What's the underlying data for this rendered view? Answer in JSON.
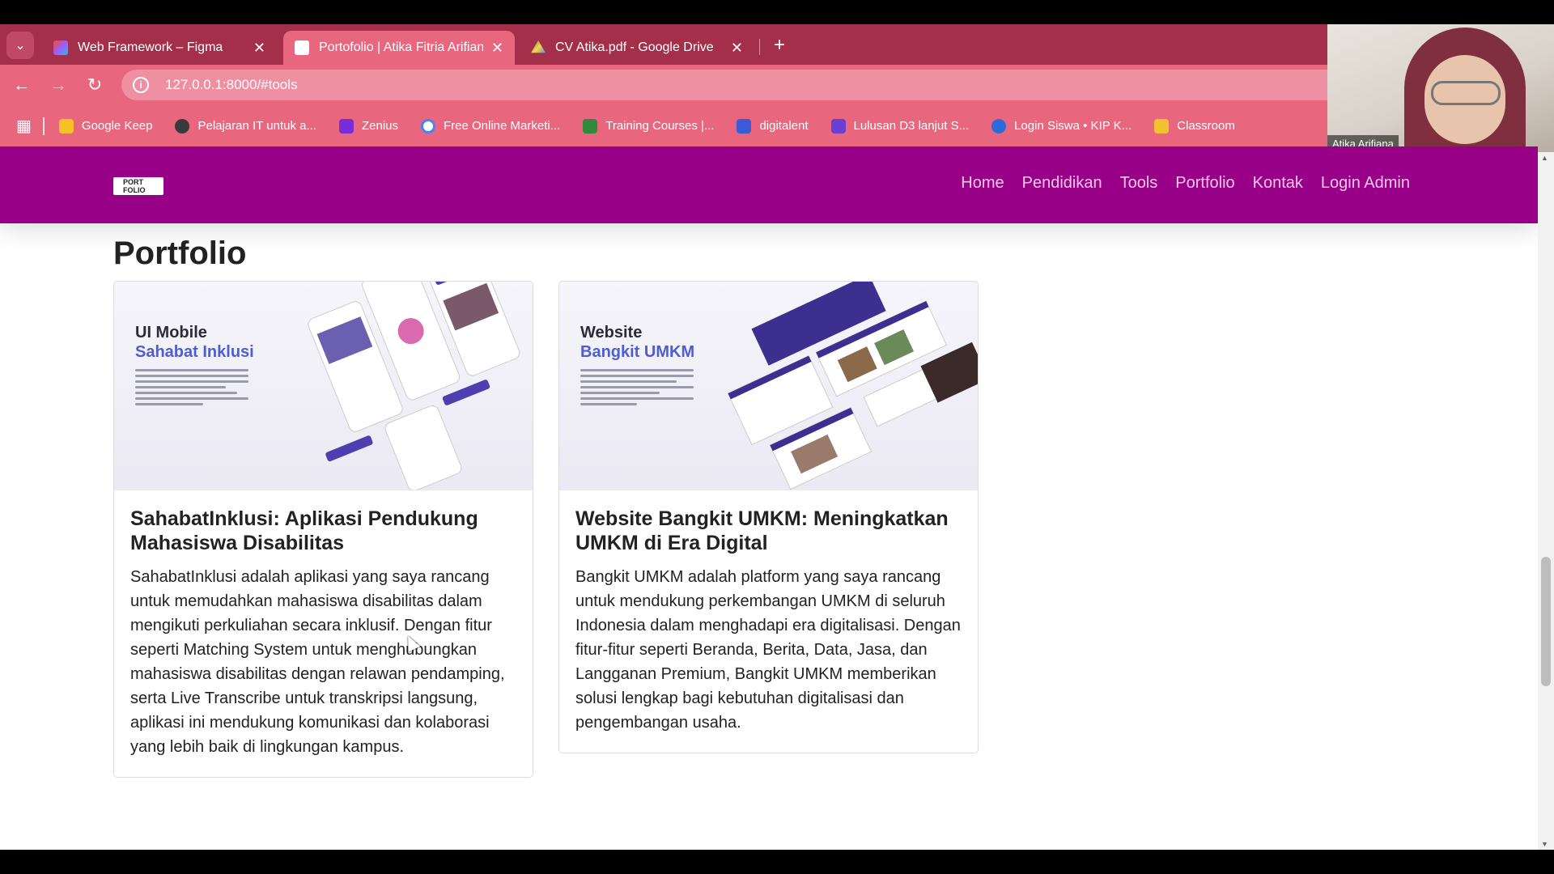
{
  "browser": {
    "tabs": [
      {
        "title": "Web Framework – Figma",
        "active": false
      },
      {
        "title": "Portofolio | Atika Fitria Arifiana",
        "active": true
      },
      {
        "title": "CV Atika.pdf - Google Drive",
        "active": false
      }
    ],
    "url": "127.0.0.1:8000/#tools",
    "bookmarks": [
      {
        "label": "Google Keep",
        "color": "#f6c026"
      },
      {
        "label": "Pelajaran IT untuk a...",
        "color": "#3a3a3a"
      },
      {
        "label": "Zenius",
        "color": "#7a2ad9"
      },
      {
        "label": "Free Online Marketi...",
        "color": "#ffffff"
      },
      {
        "label": "Training Courses  |...",
        "color": "#2f8a3b"
      },
      {
        "label": "digitalent",
        "color": "#3b5bd6"
      },
      {
        "label": "Lulusan D3 lanjut S...",
        "color": "#6a3fd1"
      },
      {
        "label": "Login Siswa • KIP K...",
        "color": "#2d6bd9"
      },
      {
        "label": "Classroom",
        "color": "#f2c230"
      }
    ]
  },
  "webcam": {
    "name": "Atika Arifiana"
  },
  "site": {
    "logo": "PORT\nFOLIO",
    "nav": [
      "Home",
      "Pendidikan",
      "Tools",
      "Portfolio",
      "Kontak",
      "Login Admin"
    ],
    "section_title": "Portfolio",
    "cards": [
      {
        "img_line1": "UI Mobile",
        "img_line2": "Sahabat Inklusi",
        "title": "SahabatInklusi: Aplikasi Pendukung Mahasiswa Disabilitas",
        "text": "SahabatInklusi adalah aplikasi yang saya rancang untuk memudahkan mahasiswa disabilitas dalam mengikuti perkuliahan secara inklusif. Dengan fitur seperti Matching System untuk menghubungkan mahasiswa disabilitas dengan relawan pendamping, serta Live Transcribe untuk transkripsi langsung, aplikasi ini mendukung komunikasi dan kolaborasi yang lebih baik di lingkungan kampus."
      },
      {
        "img_line1": "Website",
        "img_line2": "Bangkit UMKM",
        "title": "Website Bangkit UMKM: Meningkatkan UMKM di Era Digital",
        "text": "Bangkit UMKM adalah platform yang saya rancang untuk mendukung perkembangan UMKM di seluruh Indonesia dalam menghadapi era digitalisasi. Dengan fitur-fitur seperti Beranda, Berita, Data, Jasa, dan Langganan Premium, Bangkit UMKM memberikan solusi lengkap bagi kebutuhan digitalisasi dan pengembangan usaha."
      }
    ]
  }
}
